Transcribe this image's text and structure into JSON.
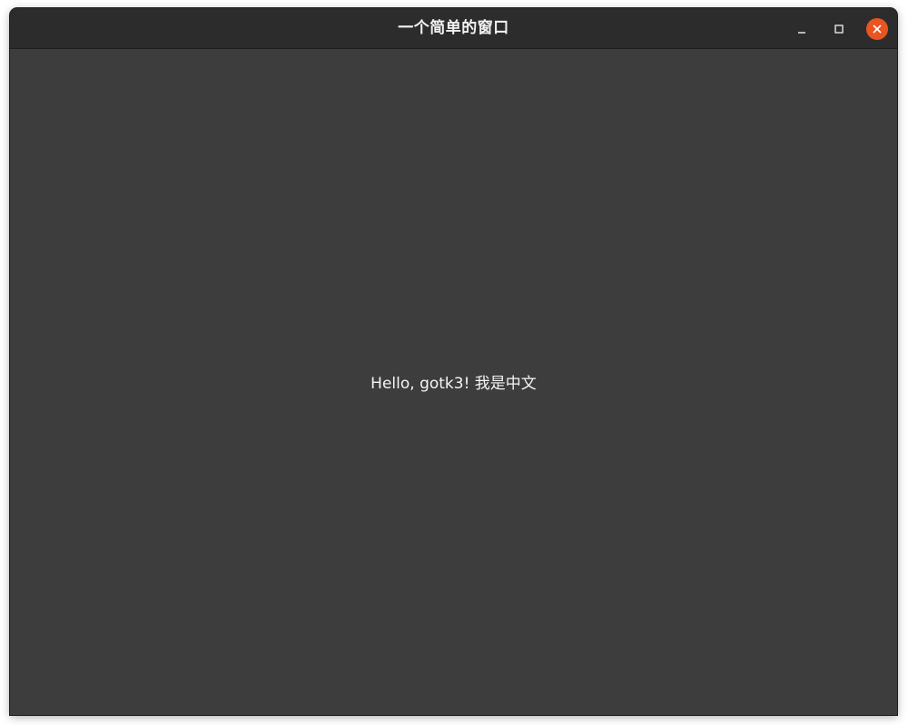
{
  "window": {
    "title": "一个简单的窗口",
    "accent_color": "#e95420",
    "background_color": "#3d3d3d",
    "titlebar_color": "#2c2c2c"
  },
  "controls": {
    "minimize_icon": "minimize-icon",
    "maximize_icon": "maximize-icon",
    "close_icon": "close-icon"
  },
  "content": {
    "label": "Hello, gotk3! 我是中文"
  }
}
